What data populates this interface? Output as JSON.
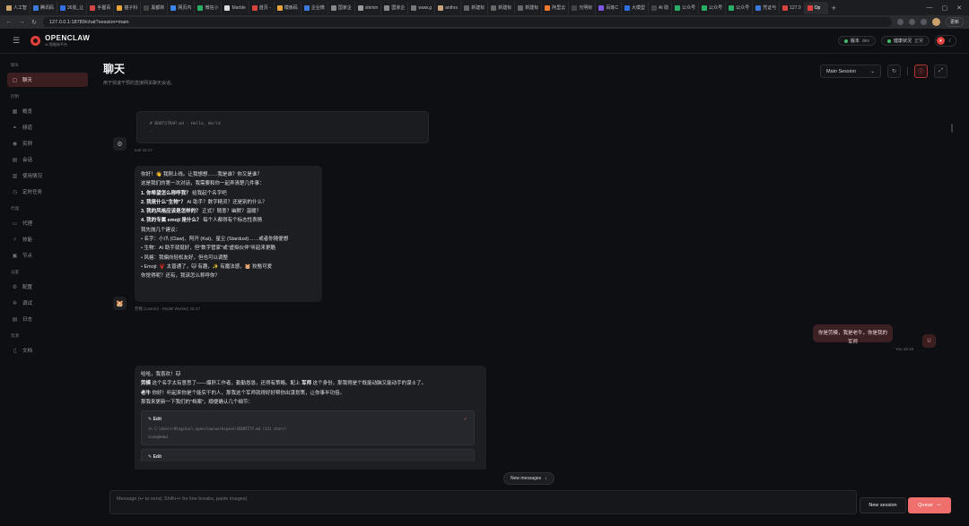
{
  "browser": {
    "tabs": [
      {
        "label": "人工智",
        "color": "#c9a36b"
      },
      {
        "label": "腾讯码",
        "color": "#3c7ad9"
      },
      {
        "label": "36氪_让",
        "color": "#2f6fe0"
      },
      {
        "label": "手握百",
        "color": "#d64545"
      },
      {
        "label": "猫子科",
        "color": "#e8a33c"
      },
      {
        "label": "黑都新",
        "color": "#444"
      },
      {
        "label": "网页内",
        "color": "#3a86e8"
      },
      {
        "label": "微信小",
        "color": "#2aae67"
      },
      {
        "label": "Marble",
        "color": "#ddd"
      },
      {
        "label": "首页 - ",
        "color": "#d9423f"
      },
      {
        "label": "模板码",
        "color": "#e8a33c"
      },
      {
        "label": "企业微",
        "color": "#3c7ad9"
      },
      {
        "label": "国家企",
        "color": "#888"
      },
      {
        "label": "shimin",
        "color": "#999"
      },
      {
        "label": "国家企",
        "color": "#888"
      },
      {
        "label": "www.g",
        "color": "#777"
      },
      {
        "label": "anthro",
        "color": "#c7a27a"
      },
      {
        "label": "新建标",
        "color": "#666"
      },
      {
        "label": "新建标",
        "color": "#666"
      },
      {
        "label": "新建标",
        "color": "#666"
      },
      {
        "label": "阿里云",
        "color": "#ef7a2f"
      },
      {
        "label": "光明标",
        "color": "#444"
      },
      {
        "label": "百炼C",
        "color": "#7e58e0"
      },
      {
        "label": "大模型",
        "color": "#2f6fe0"
      },
      {
        "label": "AI 助",
        "color": "#444"
      },
      {
        "label": "公众号",
        "color": "#2aae67"
      },
      {
        "label": "公众号",
        "color": "#2aae67"
      },
      {
        "label": "公众号",
        "color": "#2aae67"
      },
      {
        "label": "凭证与",
        "color": "#3c7ad9"
      },
      {
        "label": "127.0",
        "color": "#d9423f"
      },
      {
        "label": "Op",
        "color": "#e0413f"
      }
    ],
    "active_tab_index": 30,
    "url": "127.0.0.1:18789/chat?session=main",
    "update_label": "更新"
  },
  "app": {
    "logo_title": "OPENCLAW",
    "logo_sub": "AI 智能体平台",
    "version_label": "版本",
    "version_value": "dev",
    "health_label": "健康状况",
    "health_value": "正常"
  },
  "sidebar": {
    "sections": [
      {
        "title": "聊天",
        "items": [
          {
            "label": "聊天",
            "icon": "chat-icon",
            "glyph": "▢",
            "active": true
          }
        ]
      },
      {
        "title": "控制",
        "items": [
          {
            "label": "概览",
            "icon": "overview-icon",
            "glyph": "▦"
          },
          {
            "label": "频道",
            "icon": "link-icon",
            "glyph": "⚭"
          },
          {
            "label": "实例",
            "icon": "radio-icon",
            "glyph": "◉"
          },
          {
            "label": "会话",
            "icon": "file-icon",
            "glyph": "▤"
          },
          {
            "label": "使用情况",
            "icon": "chart-icon",
            "glyph": "▥"
          },
          {
            "label": "定时任务",
            "icon": "clock-icon",
            "glyph": "◷"
          }
        ]
      },
      {
        "title": "代理",
        "items": [
          {
            "label": "代理",
            "icon": "folder-icon",
            "glyph": "▭"
          },
          {
            "label": "技能",
            "icon": "bolt-icon",
            "glyph": "⚡"
          },
          {
            "label": "节点",
            "icon": "monitor-icon",
            "glyph": "▣"
          }
        ]
      },
      {
        "title": "设置",
        "items": [
          {
            "label": "配置",
            "icon": "gear-icon",
            "glyph": "⚙"
          },
          {
            "label": "调试",
            "icon": "bug-icon",
            "glyph": "✲"
          },
          {
            "label": "日志",
            "icon": "log-icon",
            "glyph": "▤"
          }
        ]
      },
      {
        "title": "资源",
        "items": [
          {
            "label": "文档",
            "icon": "book-icon",
            "glyph": "▯"
          }
        ]
      }
    ]
  },
  "main": {
    "title": "聊天",
    "subtitle": "用于快速干预的直接网关聊天会话。",
    "session_select": "Main Session",
    "code_lines": [
      "# BOOTSTRAP.md - Hello, World",
      "_"
    ],
    "tool_meta": "tool 15:17",
    "assistant_meta": "劳模 (Laomo) - Model Worker) 15:17",
    "user_meta": "You 15:16",
    "msg1": {
      "p1": "你好！👋 我刚上线。让我想想……我是谁？你又是谁？",
      "p2": "这是我们的第一次对话，我需要和你一起弄清楚几件事：",
      "q1_b": "1. 你希望怎么称呼我？",
      "q1": "给我起个名字吧",
      "q2_b": "2. 我是什么\"生物\"？",
      "q2": "AI 助手？数字精灵？还是别的什么？",
      "q3_b": "3. 我的风格应该是怎样的？",
      "q3": "正式？随意？幽默？温暖？",
      "q4_b": "4. 我的专属 emoji 是什么？",
      "q4": "每个人都得有个标志性表情",
      "p3": "我先抛几个建议：",
      "bullets": [
        "名字：小爪 (Claw)、阿开 (Kai)、星尘 (Stardust)……或者你随便想",
        "生物：AI 助手就挺好，但\"数字管家\"或\"虚拟伙伴\"听起来更酷",
        "风格：我偏向轻松友好，但也可以调整",
        "Emoji: 🦞 太普通了，🐱 有趣，✨ 有魔法感，🐹 狡黠可爱"
      ],
      "p4": "你觉得呢？还有，我该怎么称呼你？"
    },
    "user_msg": "你是劳模，我是老牛，你是我的军师",
    "user_avatar": "U",
    "msg2": {
      "p1": "哈哈，我喜欢！🐱",
      "p2_b": "劳模",
      "p2": " 这个名字太有意思了——爆肝工作者，勤勤恳恳，还得有策略。配上 ",
      "p2_b2": "军师",
      "p2_end": " 这个身份，那我得是个既能动脑又能动手的谋士了。",
      "p3_b": "老牛",
      "p3": " 你好！听起来你是个能实干的人，那我这个军师就得好好帮你出谋划策，让你事半功倍。",
      "p4": "那我来更新一下我们的\"档案\"，顺便确认几个细节：",
      "tool1_title": "Edit",
      "tool1_path": "in C:\\Users\\95ngchui\\.openclaw\\workspace\\IDENTITY.md (331 chars)",
      "tool1_status": "Completed",
      "tool2_title": "Edit"
    },
    "new_messages": "New messages",
    "composer_placeholder": "Message (↩ to send, Shift+↩ for line breaks, paste images)",
    "new_session": "New session",
    "queue": "Queue",
    "queue_key": "↩"
  }
}
